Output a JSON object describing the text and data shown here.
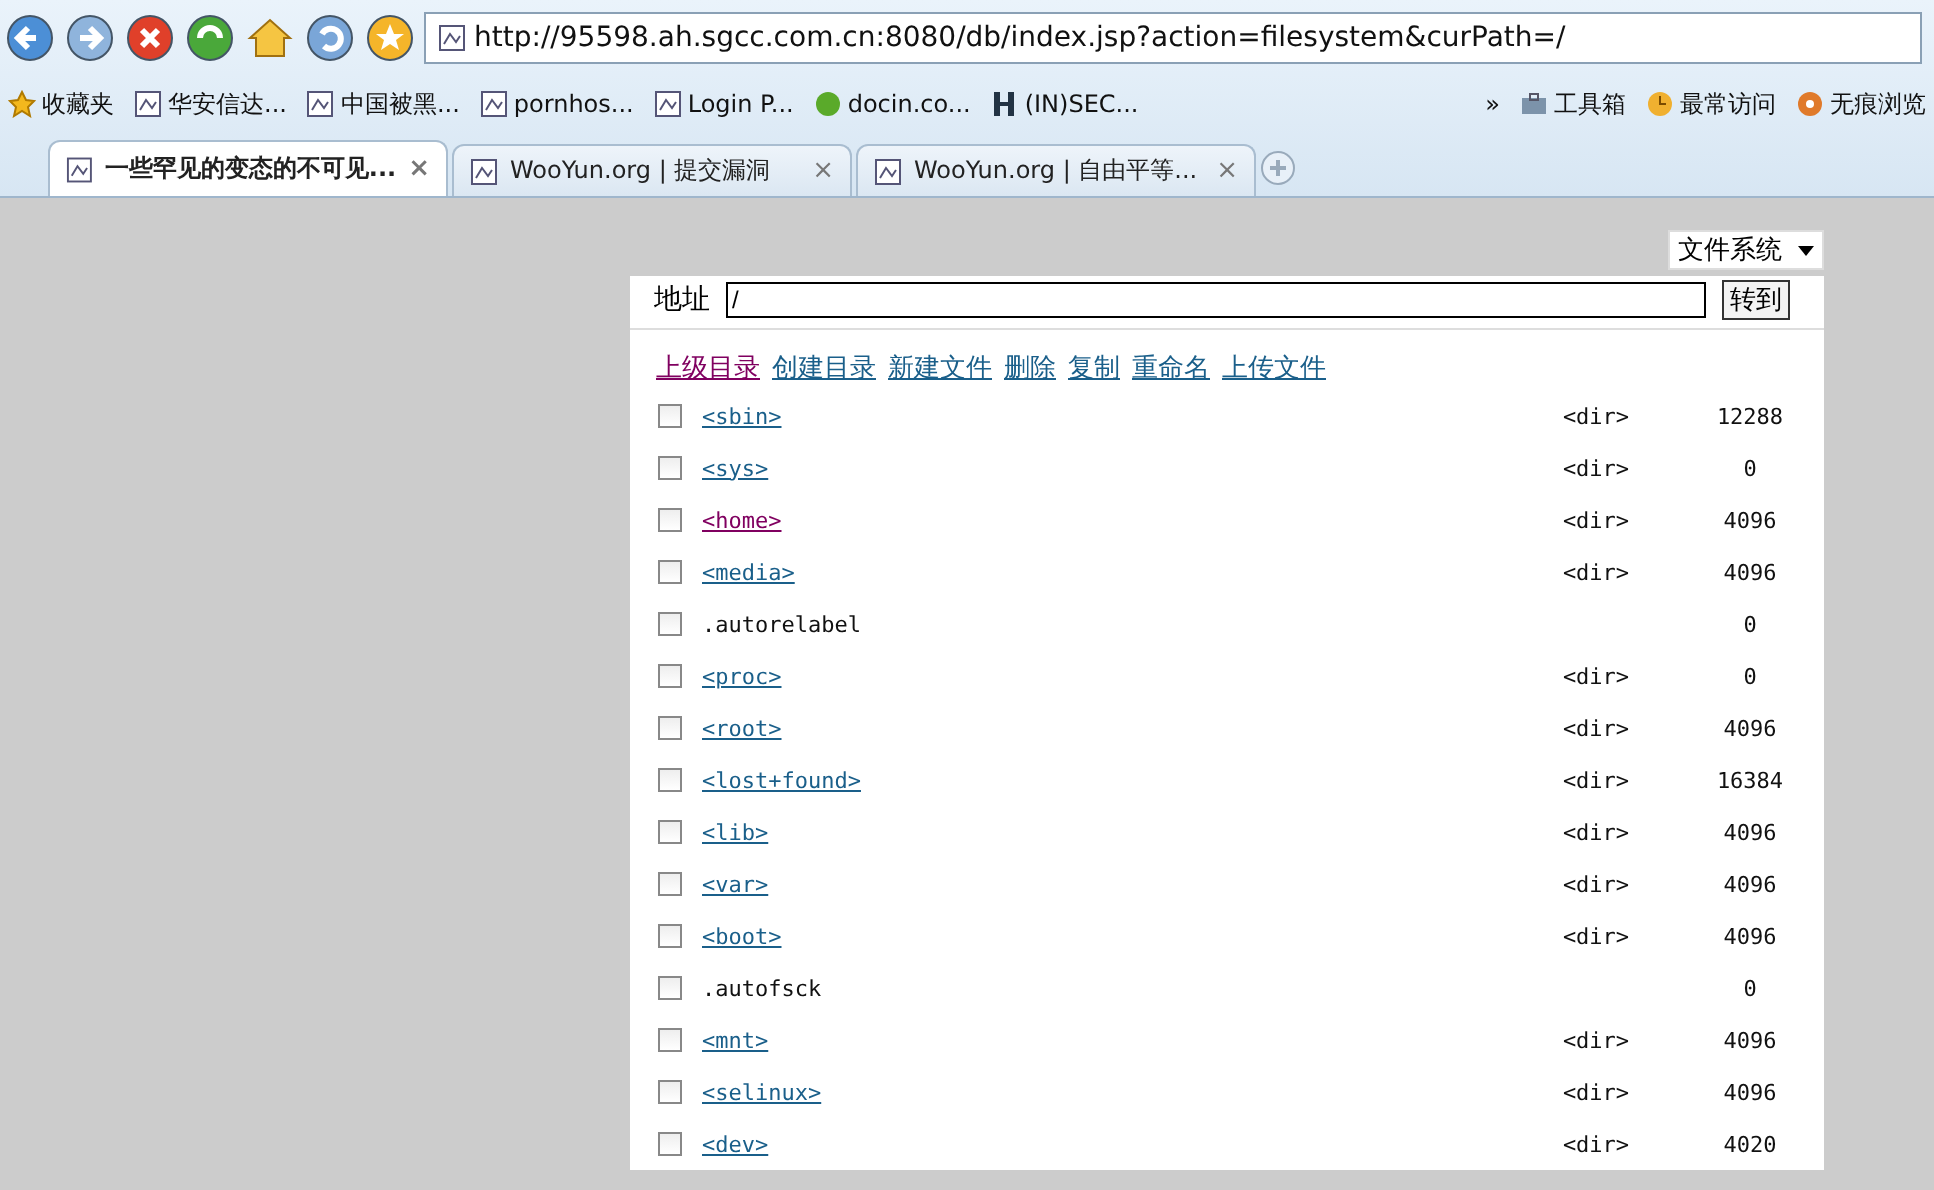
{
  "browser": {
    "address": "http://95598.ah.sgcc.com.cn:8080/db/index.jsp?action=filesystem&curPath=/",
    "bookmarks": [
      {
        "label": "收藏夹",
        "kind": "star"
      },
      {
        "label": "华安信达...",
        "kind": "page"
      },
      {
        "label": "中国被黑...",
        "kind": "page"
      },
      {
        "label": "pornhos...",
        "kind": "page"
      },
      {
        "label": "Login P...",
        "kind": "page"
      },
      {
        "label": "docin.co...",
        "kind": "docin"
      },
      {
        "label": "(IN)SEC...",
        "kind": "h"
      }
    ],
    "more": "»",
    "tools": [
      {
        "label": "工具箱",
        "kind": "toolbox"
      },
      {
        "label": "最常访问",
        "kind": "visits"
      },
      {
        "label": "无痕浏览",
        "kind": "private"
      }
    ],
    "tabs": [
      {
        "label": "一些罕见的变态的不可见...",
        "selected": true,
        "close": "×"
      },
      {
        "label": "WooYun.org | 提交漏洞",
        "selected": false,
        "close": "×"
      },
      {
        "label": "WooYun.org | 自由平等...",
        "selected": false,
        "close": "×"
      }
    ]
  },
  "page": {
    "mode_select": "文件系统",
    "address_label": "地址",
    "address_value": "/",
    "go_button": "转到",
    "actions": [
      {
        "label": "上级目录",
        "visited": true
      },
      {
        "label": "创建目录",
        "visited": false
      },
      {
        "label": "新建文件",
        "visited": false
      },
      {
        "label": "删除",
        "visited": false
      },
      {
        "label": "复制",
        "visited": false
      },
      {
        "label": "重命名",
        "visited": false
      },
      {
        "label": "上传文件",
        "visited": false
      }
    ],
    "files": [
      {
        "name": "<sbin>",
        "kind": "dir",
        "visited": false,
        "type": "<dir>",
        "size": "12288",
        "checked": false
      },
      {
        "name": "<sys>",
        "kind": "dir",
        "visited": false,
        "type": "<dir>",
        "size": "0",
        "checked": false
      },
      {
        "name": "<home>",
        "kind": "dir",
        "visited": true,
        "type": "<dir>",
        "size": "4096",
        "checked": false
      },
      {
        "name": "<media>",
        "kind": "dir",
        "visited": false,
        "type": "<dir>",
        "size": "4096",
        "checked": false
      },
      {
        "name": ".autorelabel",
        "kind": "file",
        "size": "0",
        "checked": false
      },
      {
        "name": "<proc>",
        "kind": "dir",
        "visited": false,
        "type": "<dir>",
        "size": "0",
        "checked": false
      },
      {
        "name": "<root>",
        "kind": "dir",
        "visited": false,
        "type": "<dir>",
        "size": "4096",
        "checked": false
      },
      {
        "name": "<lost+found>",
        "kind": "dir",
        "visited": false,
        "type": "<dir>",
        "size": "16384",
        "checked": false
      },
      {
        "name": "<lib>",
        "kind": "dir",
        "visited": false,
        "type": "<dir>",
        "size": "4096",
        "checked": false
      },
      {
        "name": "<var>",
        "kind": "dir",
        "visited": false,
        "type": "<dir>",
        "size": "4096",
        "checked": false
      },
      {
        "name": "<boot>",
        "kind": "dir",
        "visited": false,
        "type": "<dir>",
        "size": "4096",
        "checked": false
      },
      {
        "name": ".autofsck",
        "kind": "file",
        "size": "0",
        "checked": false
      },
      {
        "name": "<mnt>",
        "kind": "dir",
        "visited": false,
        "type": "<dir>",
        "size": "4096",
        "checked": false
      },
      {
        "name": "<selinux>",
        "kind": "dir",
        "visited": false,
        "type": "<dir>",
        "size": "4096",
        "checked": false
      },
      {
        "name": "<dev>",
        "kind": "dir",
        "visited": false,
        "type": "<dir>",
        "size": "4020",
        "checked": false
      }
    ]
  }
}
